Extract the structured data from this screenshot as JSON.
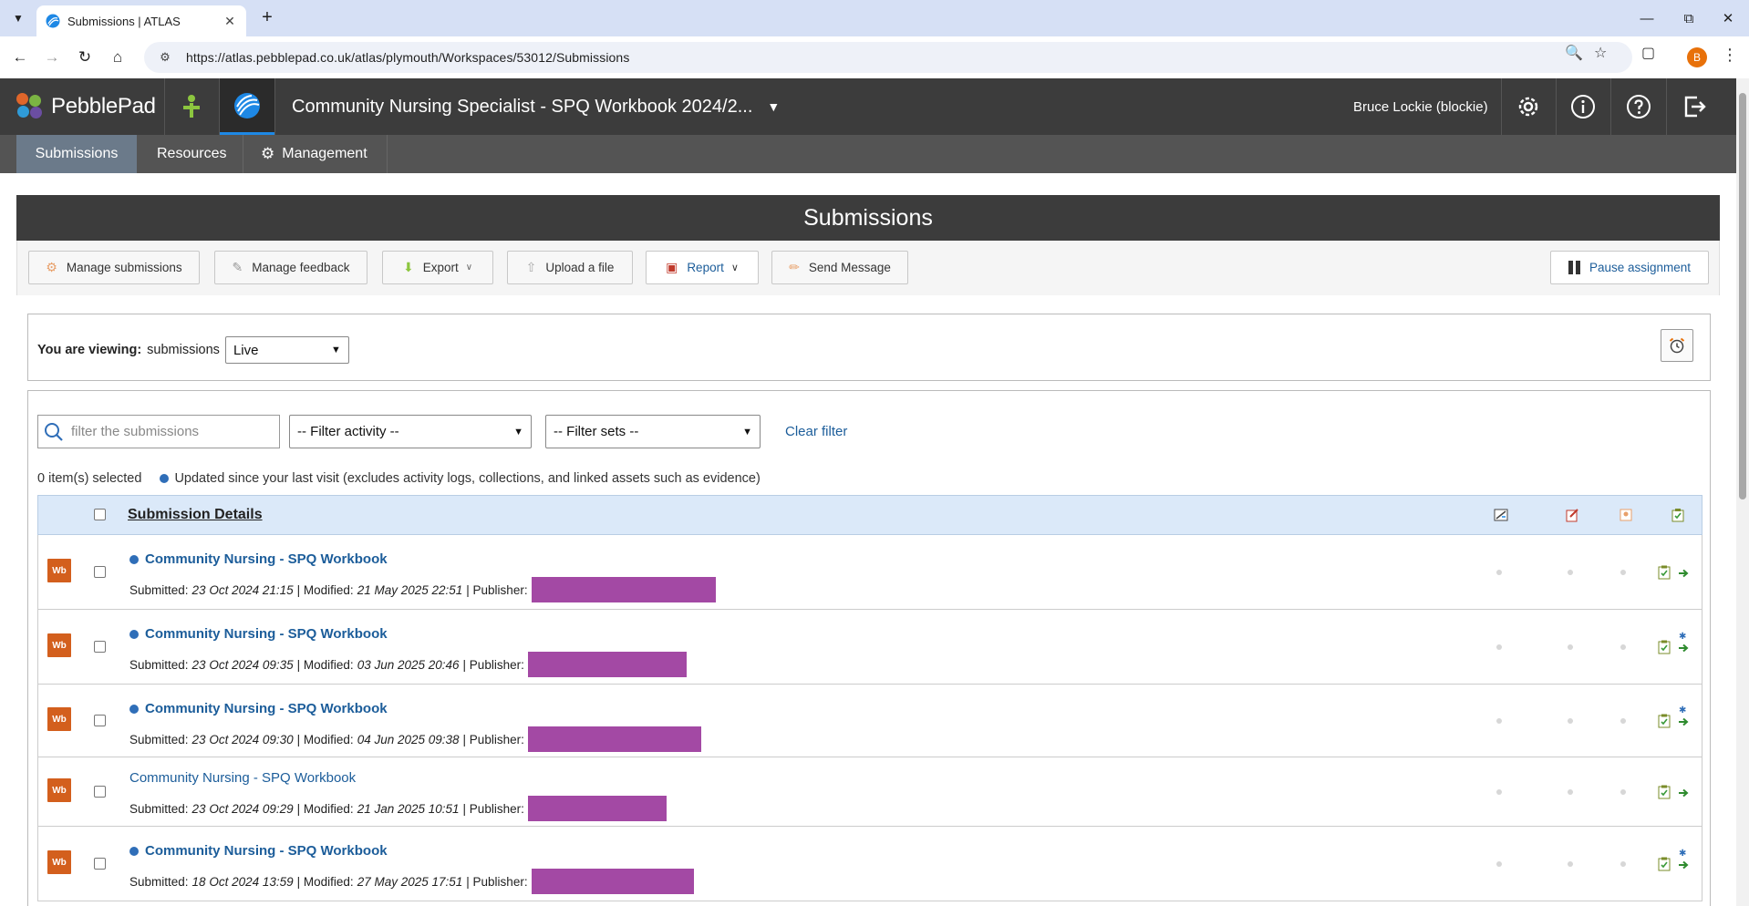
{
  "browser": {
    "tab_title": "Submissions | ATLAS",
    "url": "https://atlas.pebblepad.co.uk/atlas/plymouth/Workspaces/53012/Submissions",
    "profile_initial": "B"
  },
  "header": {
    "logo_text": "PebblePad",
    "workspace_title": "Community Nursing Specialist - SPQ Workbook 2024/2...",
    "user": "Bruce Lockie (blockie)"
  },
  "subnav": {
    "items": [
      {
        "label": "Submissions",
        "active": true
      },
      {
        "label": "Resources",
        "active": false
      },
      {
        "label": "Management",
        "active": false
      }
    ]
  },
  "page": {
    "title": "Submissions",
    "actions": {
      "manage_submissions": "Manage submissions",
      "manage_feedback": "Manage feedback",
      "export": "Export",
      "upload": "Upload a file",
      "report": "Report",
      "send_message": "Send Message",
      "pause": "Pause assignment"
    },
    "viewing": {
      "label": "You are viewing:",
      "what": "submissions",
      "selected": "Live"
    },
    "filters": {
      "search_placeholder": "filter the submissions",
      "activity": "-- Filter activity --",
      "sets": "-- Filter sets --",
      "clear": "Clear filter"
    },
    "selected_count": "0 item(s) selected",
    "updated_note": "Updated since your last visit (excludes activity logs, collections, and linked assets such as evidence)",
    "table_header": "Submission Details"
  },
  "rows": [
    {
      "badge": "Wb",
      "title": "Community Nursing - SPQ Workbook",
      "updated": true,
      "submitted_label": "Submitted:",
      "submitted": "23 Oct 2024 21:15",
      "modified_label": "| Modified:",
      "modified": "21 May 2025 22:51",
      "publisher_label": "| Publisher:",
      "new_feedback": false
    },
    {
      "badge": "Wb",
      "title": "Community Nursing - SPQ Workbook",
      "updated": true,
      "submitted_label": "Submitted:",
      "submitted": "23 Oct 2024 09:35",
      "modified_label": "| Modified:",
      "modified": "03 Jun 2025 20:46",
      "publisher_label": "| Publisher:",
      "new_feedback": true
    },
    {
      "badge": "Wb",
      "title": "Community Nursing - SPQ Workbook",
      "updated": true,
      "submitted_label": "Submitted:",
      "submitted": "23 Oct 2024 09:30",
      "modified_label": "| Modified:",
      "modified": "04 Jun 2025 09:38",
      "publisher_label": "| Publisher:",
      "new_feedback": true
    },
    {
      "badge": "Wb",
      "title": "Community Nursing - SPQ Workbook",
      "updated": false,
      "submitted_label": "Submitted:",
      "submitted": "23 Oct 2024 09:29",
      "modified_label": "| Modified:",
      "modified": "21 Jan 2025 10:51",
      "publisher_label": "| Publisher:",
      "new_feedback": false
    },
    {
      "badge": "Wb",
      "title": "Community Nursing - SPQ Workbook",
      "updated": true,
      "submitted_label": "Submitted:",
      "submitted": "18 Oct 2024 13:59",
      "modified_label": "| Modified:",
      "modified": "27 May 2025 17:51",
      "publisher_label": "| Publisher:",
      "new_feedback": true
    }
  ],
  "colors": {
    "header_bg": "#3c3c3c",
    "subnav_bg": "#545454",
    "link": "#1c5d9a",
    "badge": "#d35f1d",
    "redaction": "#a349a4",
    "table_header": "#dbe9f9"
  }
}
